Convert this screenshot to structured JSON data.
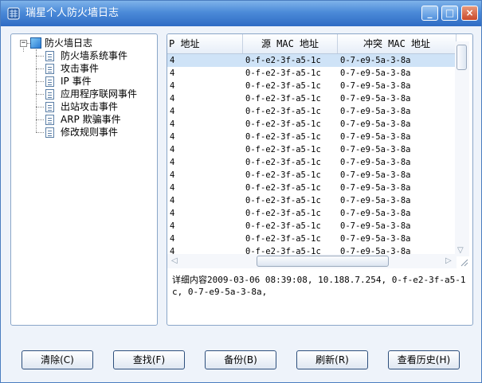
{
  "window": {
    "title": "瑞星个人防火墙日志"
  },
  "tree": {
    "root": {
      "label": "防火墙日志",
      "toggle": "−"
    },
    "items": [
      {
        "label": "防火墙系统事件"
      },
      {
        "label": "攻击事件"
      },
      {
        "label": "IP 事件"
      },
      {
        "label": "应用程序联网事件"
      },
      {
        "label": "出站攻击事件"
      },
      {
        "label": "ARP 欺骗事件"
      },
      {
        "label": "修改规则事件"
      }
    ]
  },
  "table": {
    "columns": [
      "P 地址",
      "源 MAC 地址",
      "冲突 MAC 地址"
    ],
    "rows": [
      [
        "4",
        "0-f-e2-3f-a5-1c",
        "0-7-e9-5a-3-8a"
      ],
      [
        "4",
        "0-f-e2-3f-a5-1c",
        "0-7-e9-5a-3-8a"
      ],
      [
        "4",
        "0-f-e2-3f-a5-1c",
        "0-7-e9-5a-3-8a"
      ],
      [
        "4",
        "0-f-e2-3f-a5-1c",
        "0-7-e9-5a-3-8a"
      ],
      [
        "4",
        "0-f-e2-3f-a5-1c",
        "0-7-e9-5a-3-8a"
      ],
      [
        "4",
        "0-f-e2-3f-a5-1c",
        "0-7-e9-5a-3-8a"
      ],
      [
        "4",
        "0-f-e2-3f-a5-1c",
        "0-7-e9-5a-3-8a"
      ],
      [
        "4",
        "0-f-e2-3f-a5-1c",
        "0-7-e9-5a-3-8a"
      ],
      [
        "4",
        "0-f-e2-3f-a5-1c",
        "0-7-e9-5a-3-8a"
      ],
      [
        "4",
        "0-f-e2-3f-a5-1c",
        "0-7-e9-5a-3-8a"
      ],
      [
        "4",
        "0-f-e2-3f-a5-1c",
        "0-7-e9-5a-3-8a"
      ],
      [
        "4",
        "0-f-e2-3f-a5-1c",
        "0-7-e9-5a-3-8a"
      ],
      [
        "4",
        "0-f-e2-3f-a5-1c",
        "0-7-e9-5a-3-8a"
      ],
      [
        "4",
        "0-f-e2-3f-a5-1c",
        "0-7-e9-5a-3-8a"
      ],
      [
        "4",
        "0-f-e2-3f-a5-1c",
        "0-7-e9-5a-3-8a"
      ],
      [
        "4",
        "0-f-e2-3f-a5-1c",
        "0-7-e9-5a-3-8a"
      ]
    ]
  },
  "detail": {
    "text": "详细内容2009-03-06 08:39:08, 10.188.7.254, 0-f-e2-3f-a5-1c, 0-7-e9-5a-3-8a,"
  },
  "buttons": {
    "clear": "清除(C)",
    "find": "查找(F)",
    "backup": "备份(B)",
    "refresh": "刷新(R)",
    "history": "查看历史(H)"
  },
  "window_buttons": {
    "minimize": "_",
    "maximize": "□",
    "close": "×"
  }
}
